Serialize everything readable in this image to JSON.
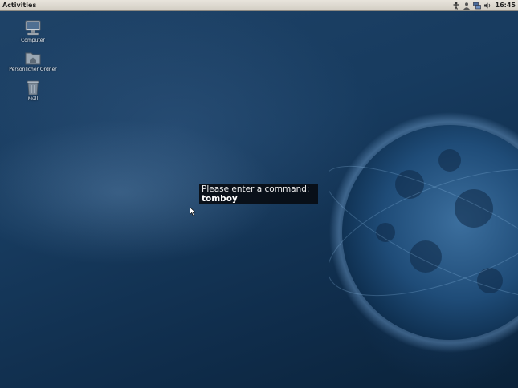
{
  "topbar": {
    "activities_label": "Activities",
    "clock": "16:45",
    "tray_icons": [
      "accessibility-icon",
      "user-status-icon",
      "network-icon",
      "volume-icon"
    ]
  },
  "desktop": {
    "icons": [
      {
        "label": "Computer",
        "icon": "computer-icon"
      },
      {
        "label": "Persönlicher Ordner",
        "icon": "home-folder-icon"
      },
      {
        "label": "Müll",
        "icon": "trash-icon"
      }
    ]
  },
  "run_dialog": {
    "prompt": "Please enter a command:",
    "input_value": "tomboy"
  },
  "colors": {
    "topbar": "#d8d4cc",
    "background": "#173b5f",
    "dialog": "#080c12"
  }
}
